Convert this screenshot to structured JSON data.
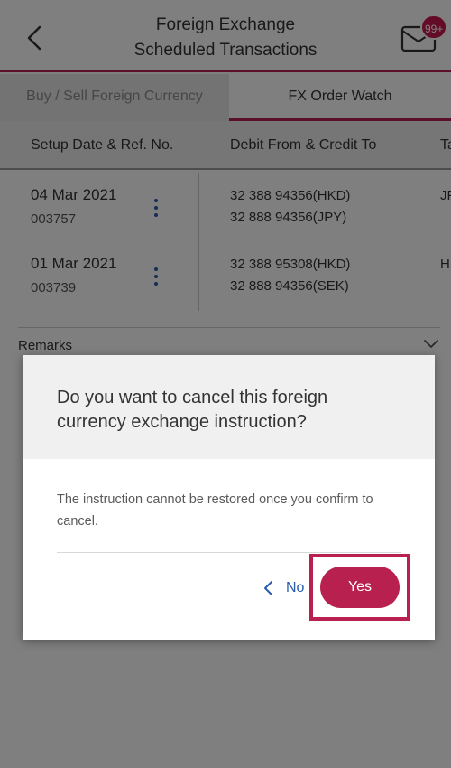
{
  "header": {
    "title_line1": "Foreign Exchange",
    "title_line2": "Scheduled Transactions",
    "badge": "99+",
    "back_icon": "chevron-left-icon",
    "inbox_icon": "mail-icon"
  },
  "tabs": [
    {
      "label": "Buy / Sell Foreign Currency",
      "active": false
    },
    {
      "label": "FX Order Watch",
      "active": true
    }
  ],
  "table": {
    "columns": [
      "Setup Date & Ref. No.",
      "Debit From & Credit To",
      "Ta"
    ],
    "rows": [
      {
        "date": "04 Mar 2021",
        "ref": "003757",
        "debit": "32 388 94356(HKD)",
        "credit": "32 888 94356(JPY)",
        "col3": "JF"
      },
      {
        "date": "01 Mar 2021",
        "ref": "003739",
        "debit": "32 388 95308(HKD)",
        "credit": "32 888 94356(SEK)",
        "col3": "H"
      }
    ]
  },
  "remarks": {
    "label": "Remarks"
  },
  "dialog": {
    "title": "Do you want to cancel this foreign currency exchange instruction?",
    "message": "The instruction cannot be restored once you confirm to cancel.",
    "no_label": "No",
    "yes_label": "Yes"
  },
  "colors": {
    "brand": "#b8204f",
    "link": "#2a5caa"
  }
}
